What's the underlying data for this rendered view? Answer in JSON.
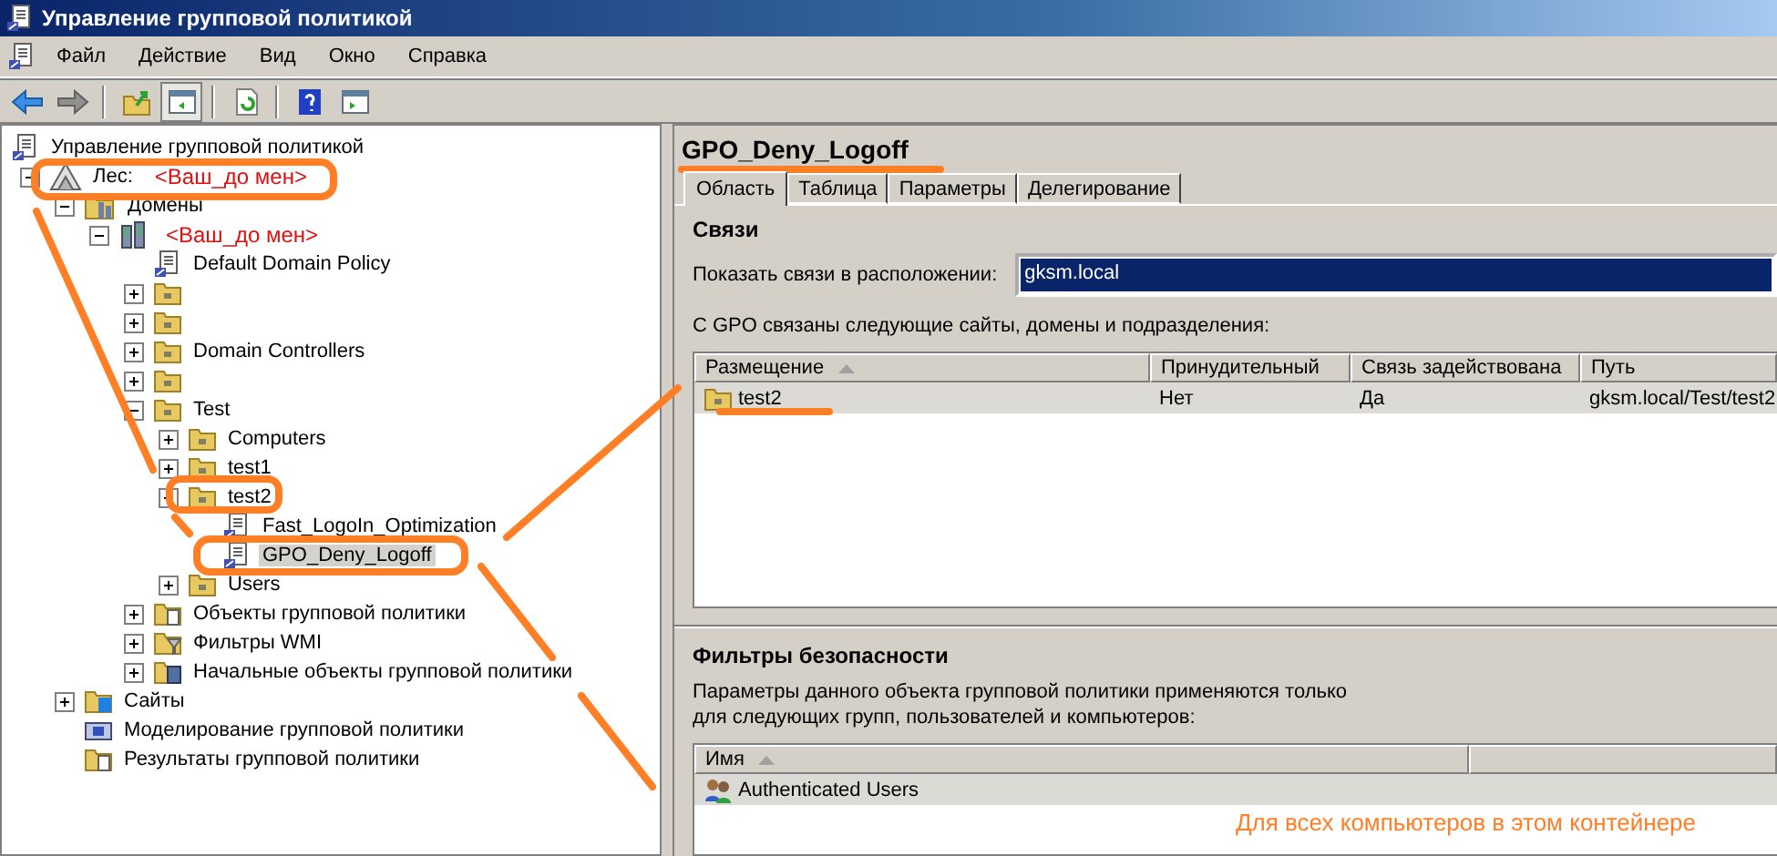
{
  "window": {
    "title": "Управление групповой политикой"
  },
  "menu": [
    {
      "label": "Файл"
    },
    {
      "label": "Действие"
    },
    {
      "label": "Вид"
    },
    {
      "label": "Окно"
    },
    {
      "label": "Справка"
    }
  ],
  "toolbar": [
    {
      "kind": "back",
      "pressed": false
    },
    {
      "kind": "forward",
      "pressed": false
    },
    {
      "kind": "separator"
    },
    {
      "kind": "up",
      "pressed": false
    },
    {
      "kind": "tree-toggle",
      "pressed": true
    },
    {
      "kind": "separator"
    },
    {
      "kind": "refresh",
      "pressed": false
    },
    {
      "kind": "separator"
    },
    {
      "kind": "help",
      "pressed": false
    },
    {
      "kind": "pane-toggle",
      "pressed": false
    }
  ],
  "tree": {
    "label": "Управление групповой политикой",
    "kind": "console",
    "selected": false,
    "children": [
      {
        "label": "Лес:",
        "annotation": "<Ваш_до мен>",
        "kind": "forest",
        "expanded": true,
        "selected": false,
        "children": [
          {
            "label": "Домены",
            "kind": "domains",
            "expanded": true,
            "selected": false,
            "children": [
              {
                "annotation": "<Ваш_до мен>",
                "kind": "domain",
                "expanded": true,
                "selected": false,
                "children": [
                  {
                    "label": "Default Domain Policy",
                    "kind": "gpo-link",
                    "selected": false
                  },
                  {
                    "kind": "ou",
                    "expanded": false,
                    "selected": false
                  },
                  {
                    "kind": "ou",
                    "expanded": false,
                    "selected": false
                  },
                  {
                    "label": "Domain Controllers",
                    "kind": "ou",
                    "expanded": false,
                    "selected": false
                  },
                  {
                    "kind": "ou",
                    "expanded": false,
                    "selected": false
                  },
                  {
                    "label": "Test",
                    "kind": "ou",
                    "expanded": true,
                    "selected": false,
                    "children": [
                      {
                        "label": "Computers",
                        "kind": "ou",
                        "expanded": false,
                        "selected": false
                      },
                      {
                        "label": "test1",
                        "kind": "ou",
                        "expanded": false,
                        "selected": false
                      },
                      {
                        "label": "test2",
                        "kind": "ou",
                        "expanded": true,
                        "selected": false,
                        "children": [
                          {
                            "label": "Fast_LogoIn_Optimization",
                            "kind": "gpo-link",
                            "selected": false
                          },
                          {
                            "label": "GPO_Deny_Logoff",
                            "kind": "gpo-link",
                            "selected": true
                          }
                        ]
                      },
                      {
                        "label": "Users",
                        "kind": "ou",
                        "expanded": false,
                        "selected": false
                      }
                    ]
                  },
                  {
                    "label": "Объекты групповой политики",
                    "kind": "gpo-container",
                    "expanded": false,
                    "selected": false
                  },
                  {
                    "label": "Фильтры WMI",
                    "kind": "wmi",
                    "expanded": false,
                    "selected": false
                  },
                  {
                    "label": "Начальные объекты групповой политики",
                    "kind": "starter",
                    "expanded": false,
                    "selected": false
                  }
                ]
              }
            ]
          },
          {
            "label": "Сайты",
            "kind": "sites",
            "expanded": false,
            "selected": false
          },
          {
            "label": "Моделирование групповой политики",
            "kind": "modeling",
            "selected": false
          },
          {
            "label": "Результаты групповой политики",
            "kind": "results",
            "selected": false
          }
        ]
      }
    ]
  },
  "details": {
    "title": "GPO_Deny_Logoff",
    "tabs": [
      {
        "label": "Область",
        "selected": true
      },
      {
        "label": "Таблица",
        "selected": false
      },
      {
        "label": "Параметры",
        "selected": false
      },
      {
        "label": "Делегирование",
        "selected": false
      }
    ],
    "links": {
      "heading": "Связи",
      "location_label": "Показать связи в расположении:",
      "location_value": "gksm.local",
      "caption": "С GPO связаны следующие сайты, домены и подразделения:",
      "columns": [
        {
          "label": "Размещение",
          "sorted": true
        },
        {
          "label": "Принудительный",
          "sorted": false
        },
        {
          "label": "Связь задействована",
          "sorted": false
        },
        {
          "label": "Путь",
          "sorted": false
        }
      ],
      "rows": [
        {
          "selected": true,
          "cells": [
            "test2",
            "Нет",
            "Да",
            "gksm.local/Test/test2"
          ]
        }
      ]
    },
    "security_filtering": {
      "heading": "Фильтры безопасности",
      "caption": "Параметры данного объекта групповой политики применяются только\nдля следующих групп, пользователей и компьютеров:",
      "columns": [
        {
          "label": "Имя",
          "sorted": true
        }
      ],
      "rows": [
        {
          "name": "Authenticated Users",
          "selected": true
        }
      ]
    }
  },
  "annotations": [
    {
      "text": "Для всех компьютеров в этом контейнере"
    }
  ]
}
